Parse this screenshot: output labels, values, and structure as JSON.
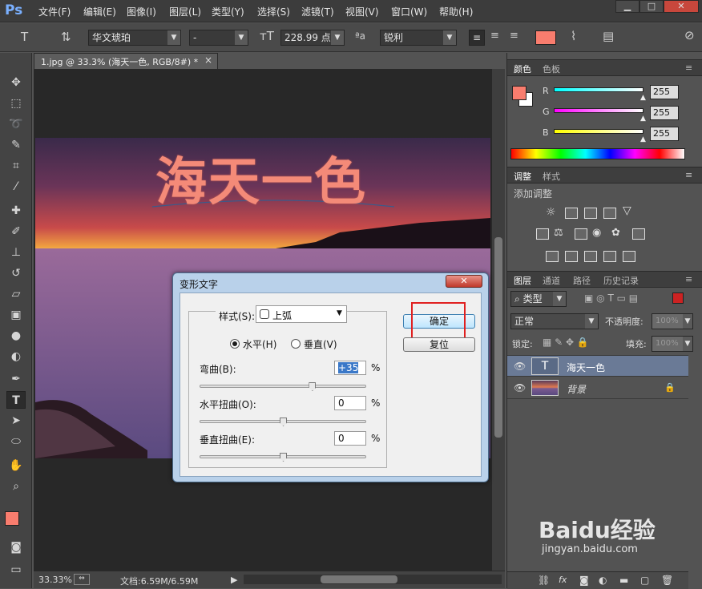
{
  "app": {
    "logo": "Ps"
  },
  "menu": [
    "文件(F)",
    "编辑(E)",
    "图像(I)",
    "图层(L)",
    "类型(Y)",
    "选择(S)",
    "滤镜(T)",
    "视图(V)",
    "窗口(W)",
    "帮助(H)"
  ],
  "window_controls": {
    "minimize": "▁",
    "maximize": "□",
    "close": "✕"
  },
  "options_bar": {
    "font_family": "华文琥珀",
    "font_style": "-",
    "font_size": "228.99 点",
    "aa_label": "ªa",
    "antialias": "锐利",
    "text_color": "#f97d6e"
  },
  "document": {
    "tab_title": "1.jpg @ 33.3% (海天一色, RGB/8#) *",
    "tab_close": "×",
    "headline": "海天一色"
  },
  "status": {
    "zoom": "33.33%",
    "doc_info": "文档:6.59M/6.59M"
  },
  "color_panel": {
    "tabs": [
      "颜色",
      "色板"
    ],
    "channels": [
      {
        "label": "R",
        "value": "255"
      },
      {
        "label": "G",
        "value": "255"
      },
      {
        "label": "B",
        "value": "255"
      }
    ],
    "foreground": "#f97d6e",
    "background": "#ffffff"
  },
  "adjust_panel": {
    "tabs": [
      "调整",
      "样式"
    ],
    "title": "添加调整"
  },
  "layers_panel": {
    "tabs": [
      "图层",
      "通道",
      "路径",
      "历史记录"
    ],
    "filter": "类型",
    "blend_mode": "正常",
    "opacity_label": "不透明度:",
    "opacity": "100%",
    "lock_label": "锁定:",
    "fill_label": "填充:",
    "fill": "100%",
    "layers": [
      {
        "name": "海天一色",
        "type": "text",
        "selected": true
      },
      {
        "name": "背景",
        "type": "image",
        "selected": false
      }
    ]
  },
  "warp_dialog": {
    "title": "变形文字",
    "close": "✕",
    "style_label": "样式(S):",
    "style_value": "上弧",
    "horizontal": "水平(H)",
    "vertical": "垂直(V)",
    "bend_label": "弯曲(B):",
    "bend_value": "+35",
    "hdist_label": "水平扭曲(O):",
    "hdist_value": "0",
    "vdist_label": "垂直扭曲(E):",
    "vdist_value": "0",
    "percent": "%",
    "ok": "确定",
    "reset": "复位",
    "bend_level": 0.675,
    "hdist_level": 0.5,
    "vdist_level": 0.5
  },
  "watermark": {
    "brand": "Baidu经验",
    "url": "jingyan.baidu.com"
  }
}
